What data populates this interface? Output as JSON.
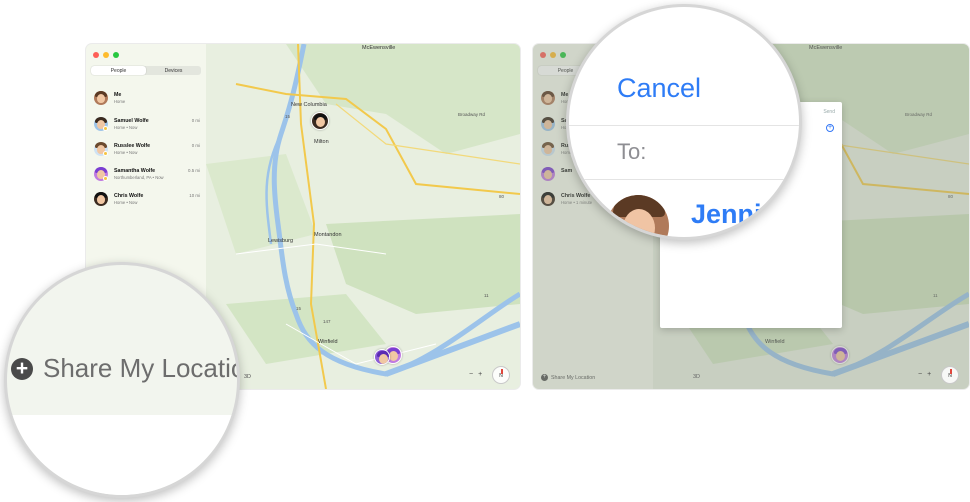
{
  "left_window": {
    "segments": [
      "People",
      "Devices"
    ],
    "people": [
      {
        "name": "Me",
        "status": "Home",
        "distance": ""
      },
      {
        "name": "Samuel Wolfe",
        "status": "Home • Now",
        "distance": "0 mi"
      },
      {
        "name": "Russlee Wolfe",
        "status": "Home • Now",
        "distance": "0 mi"
      },
      {
        "name": "Samantha Wolfe",
        "status": "Northumberland, PA • Now",
        "distance": "0.5 mi"
      },
      {
        "name": "Chris Wolfe",
        "status": "Home • Now",
        "distance": "10 mi"
      }
    ],
    "map_labels": {
      "mcewensville": "McEwensville",
      "new_columbia": "New Columbia",
      "milton": "Milton",
      "lewisburg": "Lewisburg",
      "montandon": "Montandon",
      "winfield": "Winfield",
      "broadway_rd": "Broadway Rd",
      "route15": "15",
      "route15b": "15",
      "route11": "11",
      "route80": "80",
      "route147": "147"
    },
    "share_small": "Share My Location",
    "view_3d": "3D",
    "zoom_minus": "−",
    "zoom_plus": "+",
    "compass": "N"
  },
  "right_window": {
    "people_short": [
      "Me",
      "Sam",
      "Rus",
      "Sam",
      "Chris Wolfe"
    ],
    "status_short": [
      "Home",
      "Home",
      "Home",
      "",
      "Home • 1 minute"
    ],
    "segment_short": "People",
    "sheet_send": "Send",
    "map_labels": {
      "mcewensville": "McEwensville",
      "broadway_rd": "Broadway Rd",
      "winfield": "Winfield",
      "route80": "80",
      "route11": "11"
    },
    "share_small": "Share My Location",
    "view_3d": "3D",
    "zoom_minus": "−",
    "zoom_plus": "+",
    "compass": "N"
  },
  "lens_left": {
    "share_label": "Share My Locatio",
    "plus": "+"
  },
  "lens_right": {
    "cancel": "Cancel",
    "to_label": "To:",
    "contact_name": "Jennif"
  },
  "colors": {
    "accent": "#2e7cf6",
    "map_bg": "#e8efe0",
    "river": "#9cc3ea",
    "road_major": "#f2c94c"
  }
}
